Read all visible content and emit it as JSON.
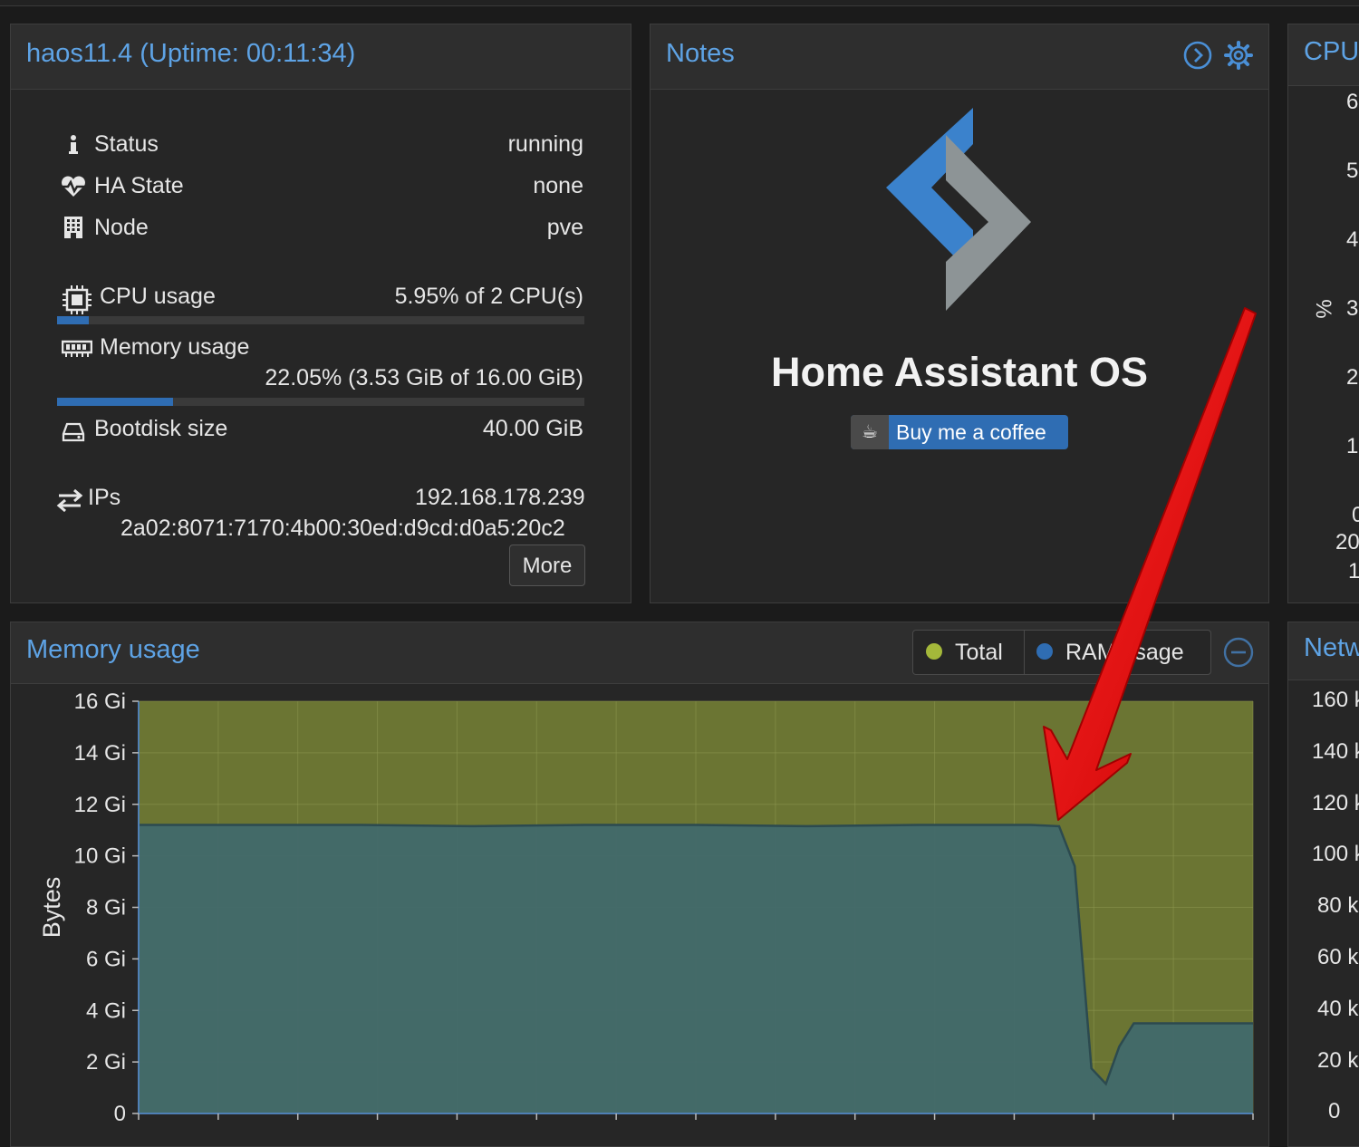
{
  "status_panel": {
    "title": "haos11.4 (Uptime: 00:11:34)",
    "rows": [
      {
        "label": "Status",
        "value": "running",
        "icon": "info-icon"
      },
      {
        "label": "HA State",
        "value": "none",
        "icon": "heartbeat-icon"
      },
      {
        "label": "Node",
        "value": "pve",
        "icon": "building-icon"
      }
    ],
    "cpu": {
      "label": "CPU usage",
      "value": "5.95% of 2 CPU(s)",
      "fraction": 0.0595
    },
    "memory": {
      "label": "Memory usage",
      "value": "22.05% (3.53 GiB of 16.00 GiB)",
      "fraction": 0.2205
    },
    "bootdisk": {
      "label": "Bootdisk size",
      "value": "40.00 GiB"
    },
    "ips": {
      "label": "IPs",
      "ipv4": "192.168.178.239",
      "ipv6": "2a02:8071:7170:4b00:30ed:d9cd:d0a5:20c2"
    },
    "more_label": "More"
  },
  "notes_panel": {
    "title": "Notes",
    "heading": "Home Assistant OS",
    "coffee_label": "Buy me a coffee",
    "coffee_icon": "coffee-cup-icon"
  },
  "cpu_panel": {
    "title": "CPU",
    "y_axis_label": "%",
    "partial_ticks": [
      "6",
      "5",
      "4",
      "3",
      "2",
      "1",
      "0"
    ],
    "partial_x_tick": "20",
    "partial_x_tick2": "1"
  },
  "network_panel": {
    "title": "Netw",
    "partial_ticks": [
      "160 k",
      "140 k",
      "120 k",
      "100 k",
      "80 k",
      "60 k",
      "40 k",
      "20 k",
      "0"
    ]
  },
  "memory_panel": {
    "title": "Memory usage",
    "legend": [
      {
        "label": "Total",
        "color": "#a4b83a"
      },
      {
        "label": "RAM usage",
        "color": "#2f6db3"
      }
    ]
  },
  "colors": {
    "accent": "#5ea3e5",
    "total_area": "#6b7533",
    "ram_area": "#41696b",
    "annotation_arrow": "#e00000"
  },
  "chart_data": {
    "type": "area",
    "ylabel": "Bytes",
    "ylim": [
      0,
      16
    ],
    "y_unit": "Gi",
    "y_ticks": [
      "0",
      "2 Gi",
      "4 Gi",
      "6 Gi",
      "8 Gi",
      "10 Gi",
      "12 Gi",
      "14 Gi",
      "16 Gi"
    ],
    "series": [
      {
        "name": "Total",
        "x": [
          0,
          1
        ],
        "values": [
          16,
          16
        ]
      },
      {
        "name": "RAM usage",
        "x": [
          0,
          0.1,
          0.2,
          0.3,
          0.4,
          0.5,
          0.6,
          0.7,
          0.8,
          0.826,
          0.84,
          0.855,
          0.868,
          0.88,
          0.893,
          0.9,
          1.0
        ],
        "values": [
          11.2,
          11.2,
          11.2,
          11.15,
          11.2,
          11.2,
          11.15,
          11.2,
          11.2,
          11.15,
          9.6,
          1.75,
          1.15,
          2.6,
          3.5,
          3.5,
          3.5
        ]
      }
    ]
  }
}
